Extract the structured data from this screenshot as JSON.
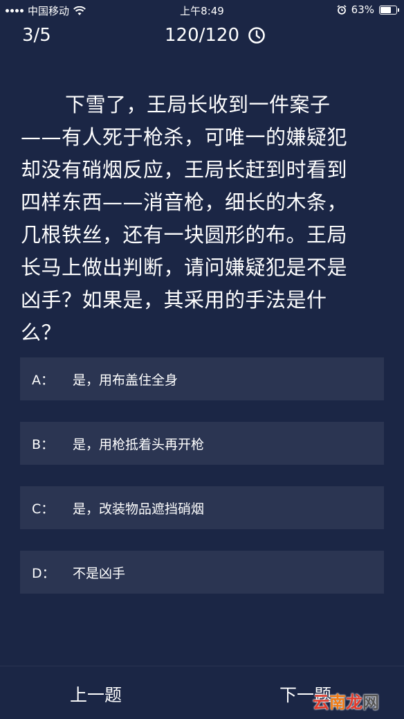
{
  "status_bar": {
    "carrier": "中国移动",
    "time": "上午8:49",
    "battery_percent_label": "63%",
    "battery_level": 0.63
  },
  "quiz": {
    "progress": "3/5",
    "timer": "120/120",
    "question": "下雪了，王局长收到一件案子——有人死于枪杀，可唯一的嫌疑犯却没有硝烟反应，王局长赶到时看到四样东西——消音枪，细长的木条，几根铁丝，还有一块圆形的布。王局长马上做出判断，请问嫌疑犯是不是凶手？如果是，其采用的手法是什么？",
    "options": [
      {
        "letter": "A：",
        "text": "是，用布盖住全身"
      },
      {
        "letter": "B：",
        "text": "是，用枪抵着头再开枪"
      },
      {
        "letter": "C：",
        "text": "是，改装物品遮挡硝烟"
      },
      {
        "letter": "D：",
        "text": "不是凶手"
      }
    ]
  },
  "nav": {
    "prev_label": "上一题",
    "next_label": "下一题"
  },
  "watermark": {
    "text": "云南龙网",
    "char1": "云",
    "char2": "南",
    "char3": "龙",
    "char4": "网"
  },
  "icons": {
    "signal": "signal-dots-icon",
    "wifi": "wifi-icon",
    "alarm": "alarm-icon",
    "battery": "battery-icon",
    "clock": "clock-icon"
  },
  "colors": {
    "background": "#1b2645",
    "option_bg": "#2b3552",
    "text": "#ffffff",
    "watermark_red": "#e23b2c",
    "watermark_orange": "#f07a12"
  }
}
